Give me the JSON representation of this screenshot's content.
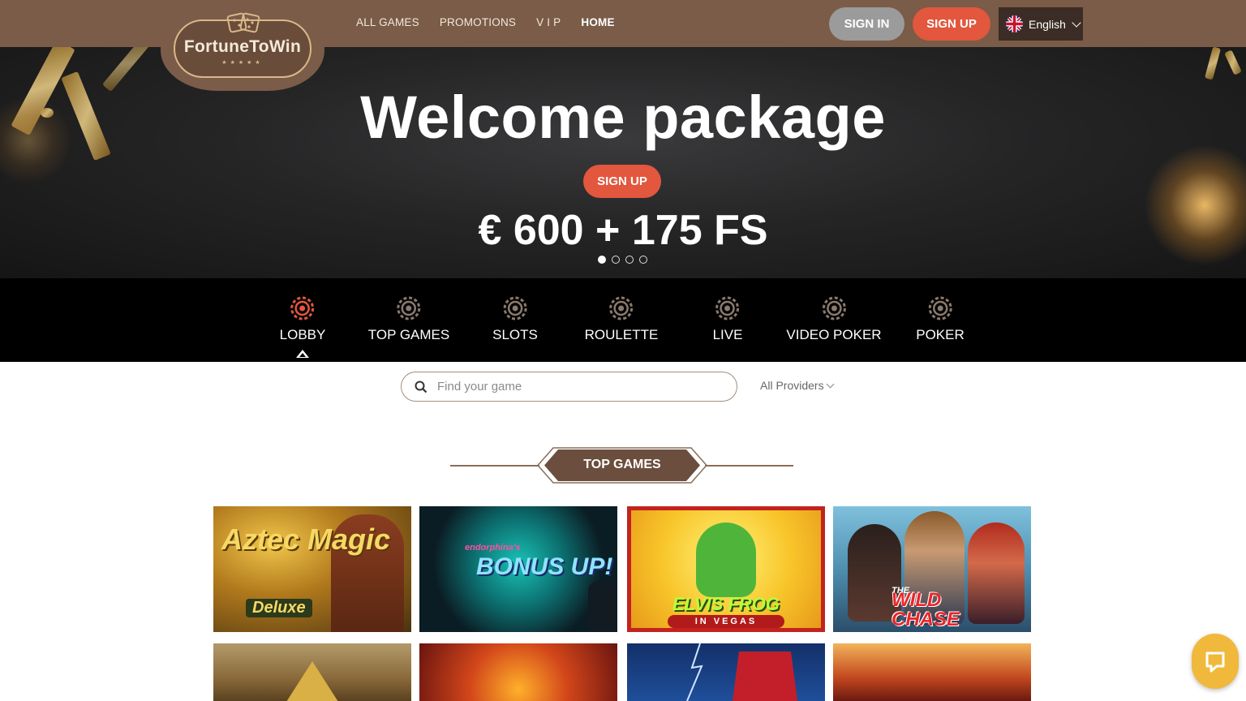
{
  "brand": {
    "name": "FortuneToWin",
    "stars": "★★★★★"
  },
  "nav": {
    "items": [
      "ALL GAMES",
      "PROMOTIONS",
      "V I P",
      "HOME"
    ],
    "active_index": 3
  },
  "auth": {
    "sign_in": "SIGN IN",
    "sign_up": "SIGN UP"
  },
  "language": {
    "label": "English",
    "flag_icon": "uk-flag-icon"
  },
  "hero": {
    "title": "Welcome package",
    "cta": "SIGN UP",
    "amount": "€ 600 + 175 FS",
    "slides": 4,
    "active_slide": 1
  },
  "categories": {
    "items": [
      "LOBBY",
      "TOP GAMES",
      "SLOTS",
      "ROULETTE",
      "LIVE",
      "VIDEO POKER",
      "POKER"
    ],
    "active_index": 0
  },
  "search": {
    "placeholder": "Find your game",
    "providers_label": "All Providers"
  },
  "section": {
    "title": "TOP GAMES"
  },
  "games": [
    {
      "title": "Aztec Magic",
      "subtitle": "Deluxe"
    },
    {
      "title": "BONUS UP!",
      "subtitle": "endorphina's"
    },
    {
      "title": "ELVIS FROG",
      "subtitle": "IN VEGAS"
    },
    {
      "title": "WILD CHASE",
      "subtitle": "THE"
    }
  ],
  "colors": {
    "header": "#7a5c48",
    "accent": "#e2573d",
    "signin": "#9b9b9b",
    "category_bar": "#000000",
    "chat": "#f0b93c"
  }
}
